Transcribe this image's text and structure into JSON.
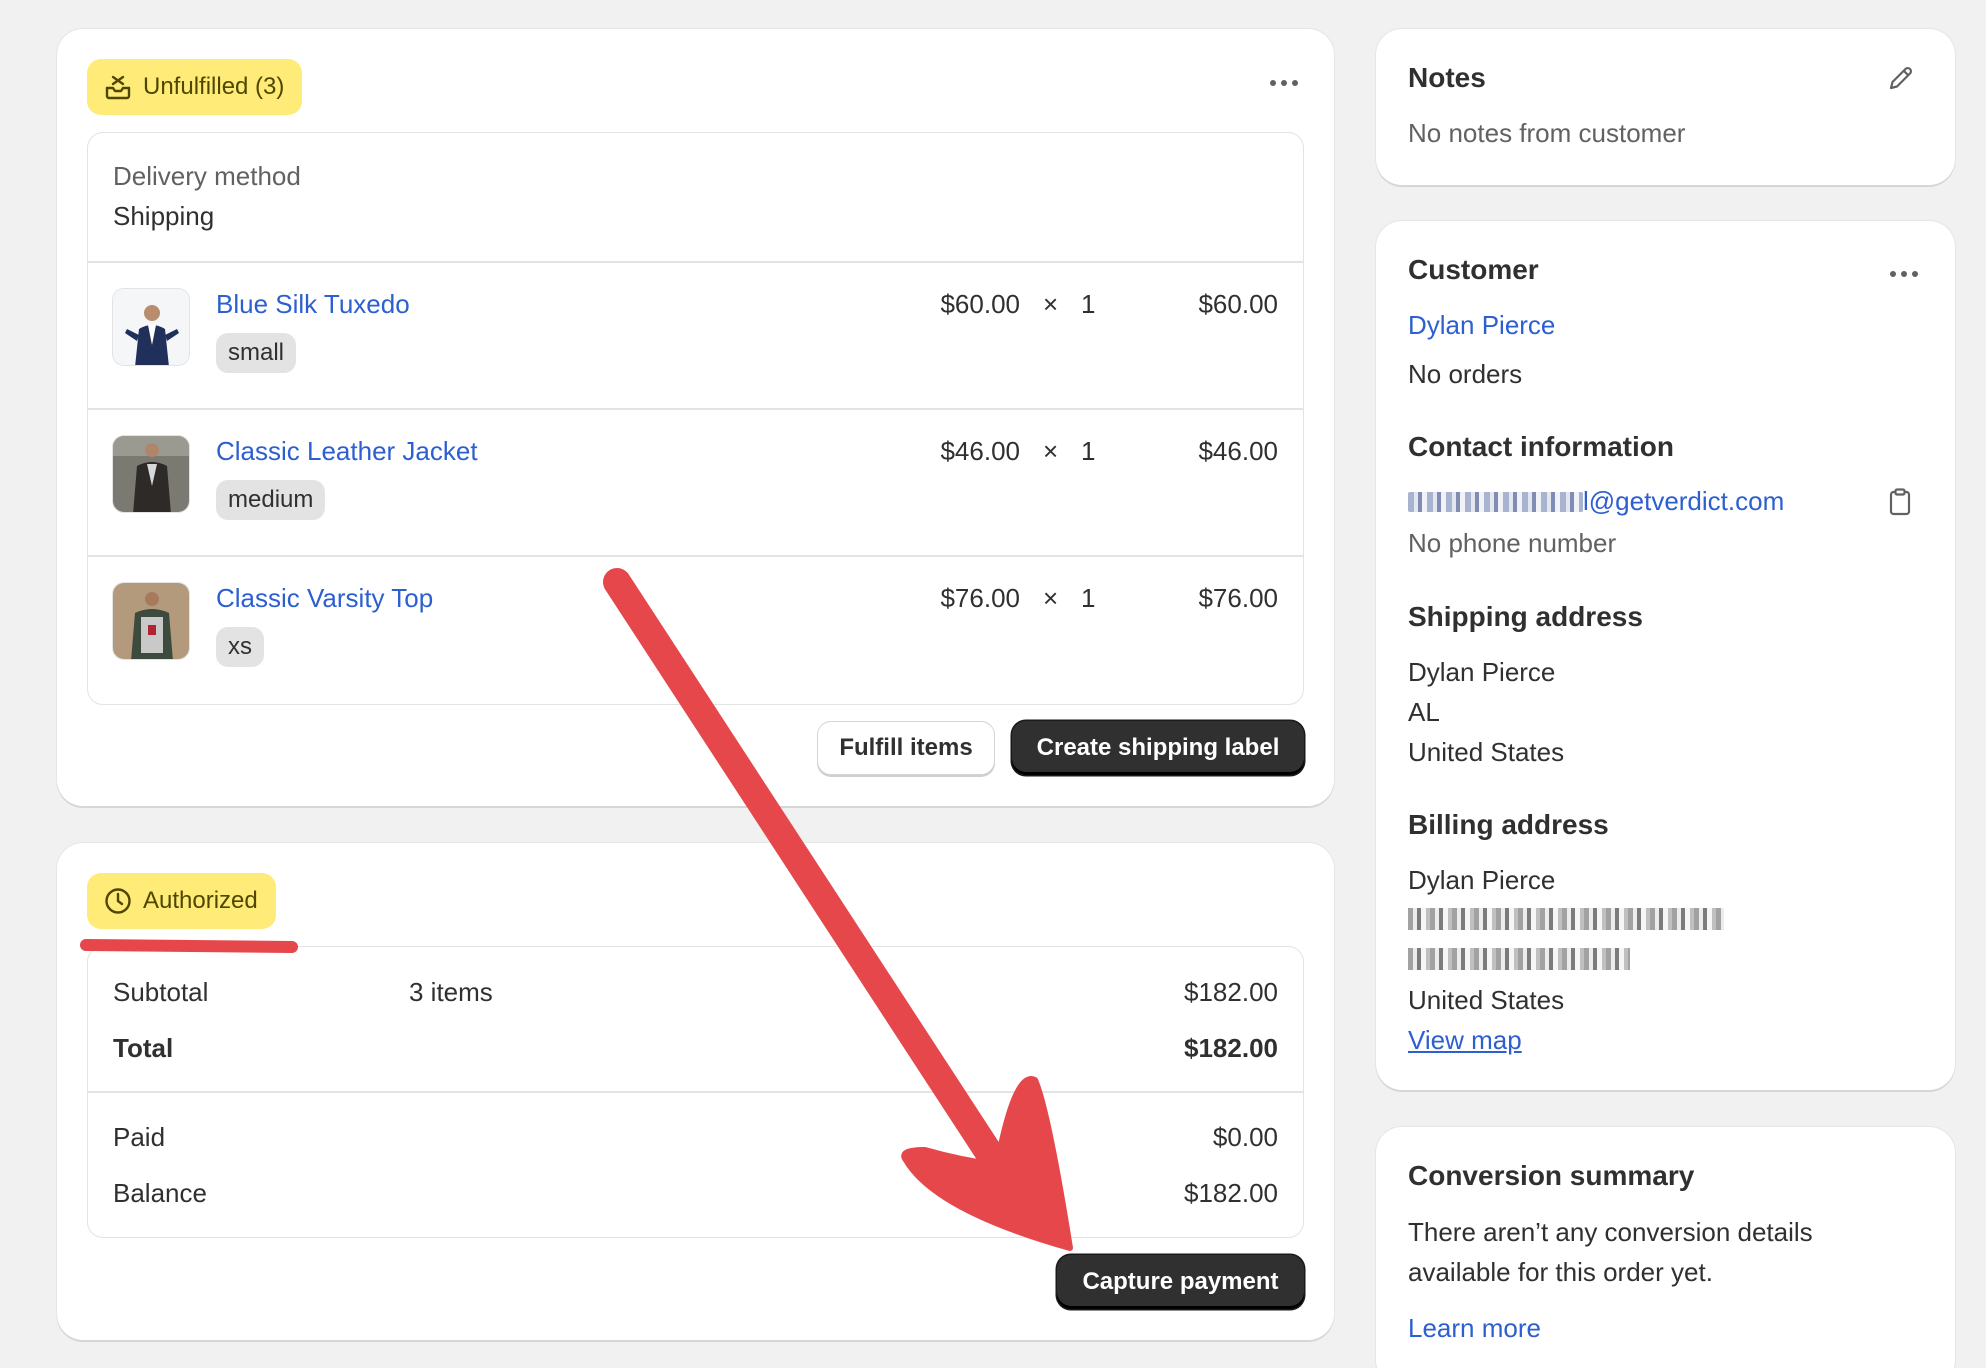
{
  "fulfillment": {
    "badge_label": "Unfulfilled (3)",
    "delivery_method_label": "Delivery method",
    "delivery_method_value": "Shipping",
    "items": [
      {
        "name": "Blue Silk Tuxedo",
        "variant": "small",
        "price": "$60.00",
        "times": "×",
        "qty": "1",
        "total": "$60.00"
      },
      {
        "name": "Classic Leather Jacket",
        "variant": "medium",
        "price": "$46.00",
        "times": "×",
        "qty": "1",
        "total": "$46.00"
      },
      {
        "name": "Classic Varsity Top",
        "variant": "xs",
        "price": "$76.00",
        "times": "×",
        "qty": "1",
        "total": "$76.00"
      }
    ],
    "fulfill_button": "Fulfill items",
    "shipping_label_button": "Create shipping label"
  },
  "payment": {
    "badge_label": "Authorized",
    "subtotal_label": "Subtotal",
    "subtotal_items": "3 items",
    "subtotal_value": "$182.00",
    "total_label": "Total",
    "total_value": "$182.00",
    "paid_label": "Paid",
    "paid_value": "$0.00",
    "balance_label": "Balance",
    "balance_value": "$182.00",
    "capture_button": "Capture payment"
  },
  "notes": {
    "title": "Notes",
    "body": "No notes from customer"
  },
  "customer": {
    "title": "Customer",
    "name": "Dylan Pierce",
    "orders": "No orders",
    "contact_title": "Contact information",
    "email_visible": "l@getverdict.com",
    "phone": "No phone number",
    "shipping_title": "Shipping address",
    "shipping_name": "Dylan Pierce",
    "shipping_region": "AL",
    "shipping_country": "United States",
    "billing_title": "Billing address",
    "billing_name": "Dylan Pierce",
    "billing_country": "United States",
    "view_map": "View map"
  },
  "conversion": {
    "title": "Conversion summary",
    "body_line1": "There aren’t any conversion details",
    "body_line2": "available for this order yet.",
    "learn_more": "Learn more"
  },
  "colors": {
    "badge_bg": "#ffeb78",
    "link": "#2c5fd0",
    "primary_button": "#303030",
    "annotation_arrow": "#e5474b"
  },
  "icons": {
    "unfulfilled": "package-inbox-icon",
    "authorized": "clock-icon",
    "notes_edit": "pencil-icon",
    "copy": "clipboard-icon",
    "menu": "more-horizontal-icon"
  }
}
